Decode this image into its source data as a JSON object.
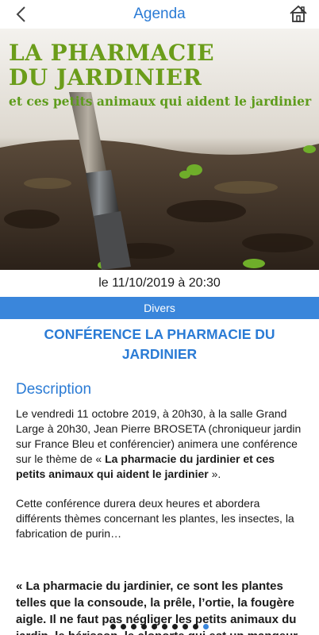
{
  "header": {
    "title": "Agenda",
    "back_icon": "chevron-left-icon",
    "home_icon": "home-icon"
  },
  "hero": {
    "title_line1": "LA PHARMACIE",
    "title_line2": "DU JARDINIER",
    "subtitle": "et ces petits animaux qui aident le jardinier"
  },
  "event": {
    "date": "le 11/10/2019 à 20:30",
    "category": "Divers",
    "title": "CONFÉRENCE LA PHARMACIE DU JARDINIER"
  },
  "description": {
    "heading": "Description",
    "p1_part1": "Le vendredi 11 octobre 2019, à 20h30, à la salle Grand Large à 20h30, Jean Pierre BROSETA (chroniqueur jardin sur France Bleu et conférencier) animera une conférence sur le thème de « ",
    "p1_bold": "La pharmacie du jardinier et ces petits animaux qui aident le jardinier",
    "p1_part2": " ».",
    "p2": "Cette conférence durera deux heures et abordera différents thèmes concernant les plantes, les insectes, la fabrication de purin…",
    "quote": "« La pharmacie du jardinier, ce sont les plantes telles que la consoude, la prêle, l’ortie, la fougère aigle. Il ne faut pas négliger les petits animaux du jardin, le hérisson, le cloporte qui est un mangeur de pucerons, le perce-oreille"
  },
  "pager": {
    "count": 10,
    "active_index": 9
  },
  "colors": {
    "accent": "#2a7bd5",
    "category_bg": "#3a86db",
    "hero_green": "#6b9d1a"
  }
}
